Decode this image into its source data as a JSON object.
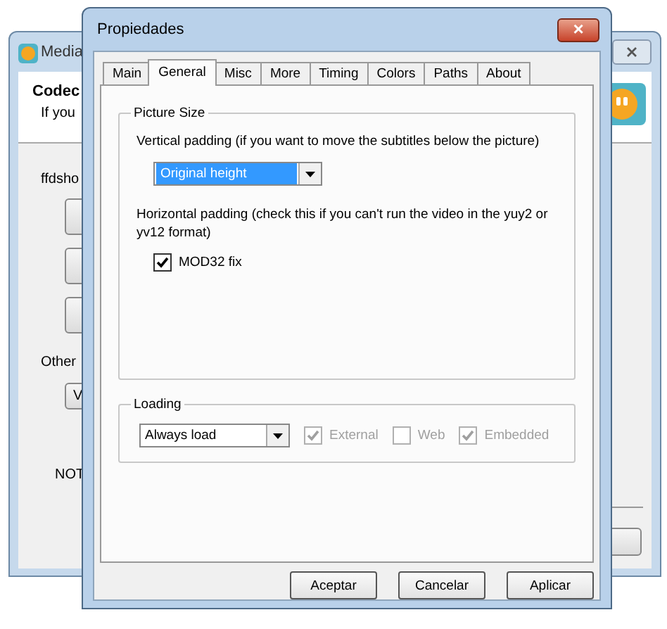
{
  "back_window": {
    "title": "Media",
    "header_title": "Codec",
    "header_text": "If you",
    "section_label": "ffdsho",
    "other_label": "Other",
    "vs_button": "V",
    "note_label": "NOT"
  },
  "dialog": {
    "title": "Propiedades",
    "close": "×",
    "tabs": [
      {
        "label": "Main",
        "selected": false
      },
      {
        "label": "General",
        "selected": true
      },
      {
        "label": "Misc",
        "selected": false
      },
      {
        "label": "More",
        "selected": false
      },
      {
        "label": "Timing",
        "selected": false
      },
      {
        "label": "Colors",
        "selected": false
      },
      {
        "label": "Paths",
        "selected": false
      },
      {
        "label": "About",
        "selected": false
      }
    ],
    "picture_size": {
      "legend": "Picture Size",
      "vertical_label": "Vertical padding (if you want to move the subtitles below the picture)",
      "vertical_value": "Original height",
      "horizontal_label": "Horizontal padding (check this if you can't run the video in the yuy2 or yv12 format)",
      "mod32": {
        "label": "MOD32 fix",
        "checked": true,
        "disabled": false
      }
    },
    "loading": {
      "legend": "Loading",
      "value": "Always load",
      "options": [
        {
          "label": "External",
          "checked": true,
          "disabled": true
        },
        {
          "label": "Web",
          "checked": false,
          "disabled": true
        },
        {
          "label": "Embedded",
          "checked": true,
          "disabled": true
        }
      ]
    },
    "buttons": [
      "Aceptar",
      "Cancelar",
      "Aplicar"
    ]
  }
}
